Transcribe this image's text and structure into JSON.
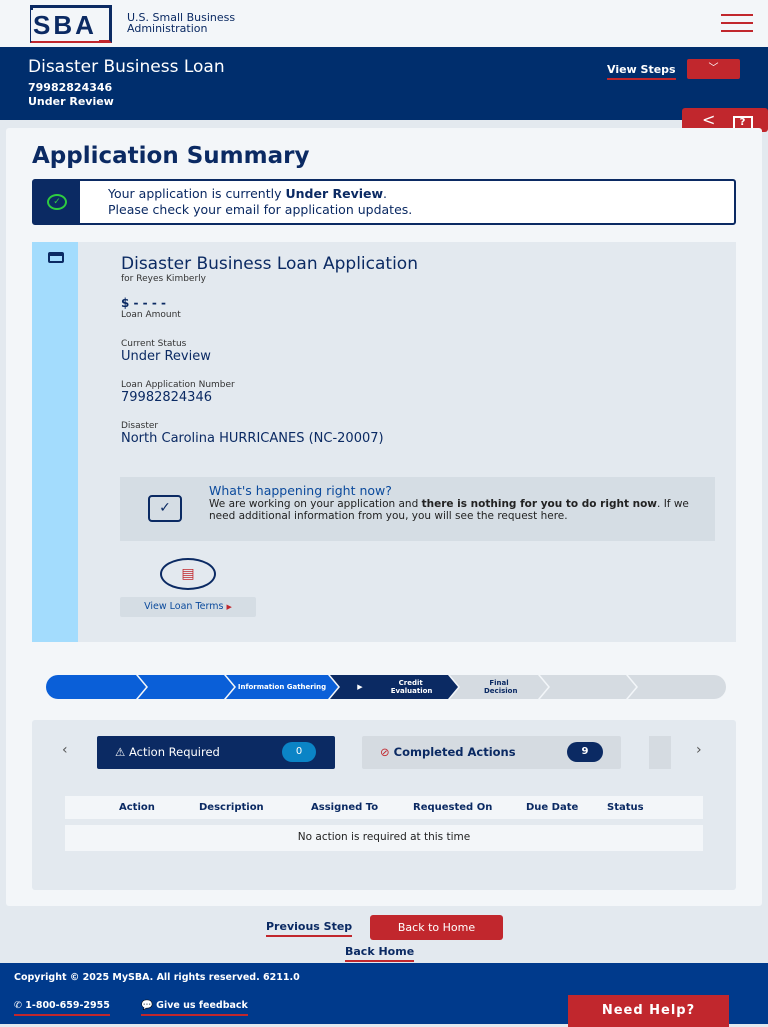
{
  "header": {
    "logo": "SBA",
    "agency_line1": "U.S. Small Business",
    "agency_line2": "Administration"
  },
  "banner": {
    "title": "Disaster Business Loan",
    "number": "79982824346",
    "status": "Under Review",
    "view_steps": "View Steps"
  },
  "page_title": "Application Summary",
  "alert": {
    "text_before": "Your application is currently ",
    "text_bold": "Under Review",
    "text_after": ".",
    "line2": "Please check your email for application updates."
  },
  "card": {
    "title": "Disaster Business Loan Application",
    "subtitle": "for Reyes Kimberly",
    "amount": "$ - - - -",
    "amount_label": "Loan Amount",
    "status_label": "Current Status",
    "status": "Under Review",
    "number_label": "Loan Application Number",
    "number": "79982824346",
    "disaster_label": "Disaster",
    "disaster": "North Carolina HURRICANES (NC-20007)",
    "happening": {
      "title": "What's happening right now?",
      "text1": "We are working on your application and ",
      "bold": "there is nothing for you to do right now",
      "text2": ". If we need additional information from you, you will see the request here."
    },
    "view_terms": "View Loan Terms"
  },
  "steps": [
    {
      "label": "",
      "state": "done"
    },
    {
      "label": "",
      "state": "done"
    },
    {
      "label": "Information Gathering",
      "state": "done"
    },
    {
      "label": "Credit Evaluation",
      "state": "current"
    },
    {
      "label": "Final Decision",
      "state": "todo"
    },
    {
      "label": "",
      "state": "todo"
    },
    {
      "label": "",
      "state": "todo"
    }
  ],
  "actions": {
    "tab_required": "Action Required",
    "required_count": "0",
    "tab_completed": "Completed Actions",
    "completed_count": "9",
    "columns": [
      "Action",
      "Description",
      "Assigned To",
      "Requested On",
      "Due Date",
      "Status"
    ],
    "empty": "No action is required at this time"
  },
  "nav": {
    "previous": "Previous Step",
    "back_home_btn": "Back to Home",
    "back_home": "Back Home"
  },
  "footer": {
    "copyright": "Copyright © 2025 MySBA. All rights reserved. 6211.0",
    "phone": "1-800-659-2955",
    "feedback": "Give us feedback",
    "help": "Need Help?"
  }
}
